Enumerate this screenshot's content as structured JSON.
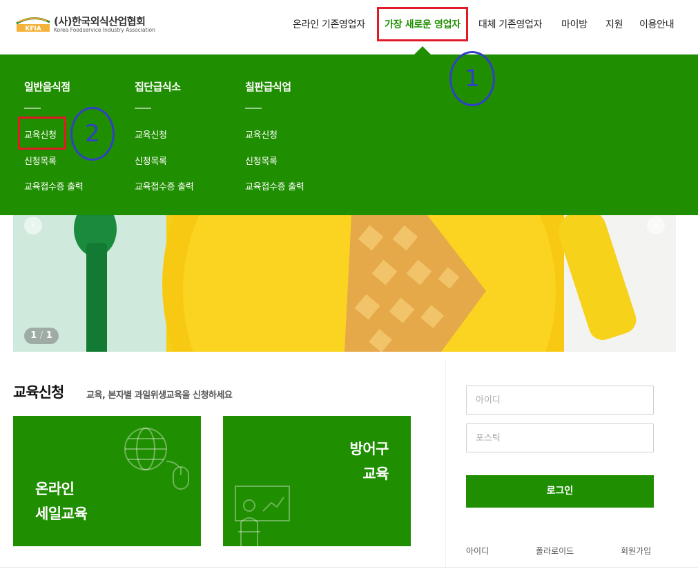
{
  "logo": {
    "mark_text": "KFIA",
    "name_ko": "(사)한국외식산업협회",
    "name_en": "Korea Foodservice Industry Association"
  },
  "gnb": {
    "items": [
      {
        "label": "온라인 기존영업자"
      },
      {
        "label": "가장 새로운 영업자"
      },
      {
        "label": "대체 기존영업자"
      },
      {
        "label": "마이방"
      },
      {
        "label": "지원"
      },
      {
        "label": "이용안내"
      }
    ],
    "active_index": 1
  },
  "mega_menu": {
    "columns": [
      {
        "title": "일반음식점",
        "links": [
          "교육신청",
          "신청목록",
          "교육접수증 출력"
        ]
      },
      {
        "title": "집단급식소",
        "links": [
          "교육신청",
          "신청목록",
          "교육접수증 출력"
        ]
      },
      {
        "title": "칠판급식업",
        "links": [
          "교육신청",
          "신청목록",
          "교육접수증 출력"
        ]
      }
    ]
  },
  "annotations": {
    "step1": "1",
    "step2": "2"
  },
  "banner": {
    "counter_current": "1",
    "counter_sep": "/",
    "counter_total": "1",
    "prev_icon": "chevron-left-icon",
    "next_icon": "chevron-right-icon"
  },
  "section": {
    "title": "교육신청",
    "subtitle": "교육, 본자별 과일위생교육을 신청하세요"
  },
  "cards": [
    {
      "line1": "온라인",
      "line2": "세일교육",
      "icon": "globe-mouse-icon"
    },
    {
      "line1": "방어구",
      "line2": "교육",
      "icon": "presentation-icon"
    }
  ],
  "login": {
    "id_placeholder": "아이디",
    "pw_placeholder": "포스틱",
    "button_label": "로그인",
    "links": [
      "아이디",
      "폴라로이드",
      "회원가입"
    ]
  },
  "colors": {
    "brand_green": "#1f8e00",
    "highlight_red": "#e11a25",
    "annotation_blue": "#3140c7",
    "banner_yellow": "#f5ce18"
  }
}
